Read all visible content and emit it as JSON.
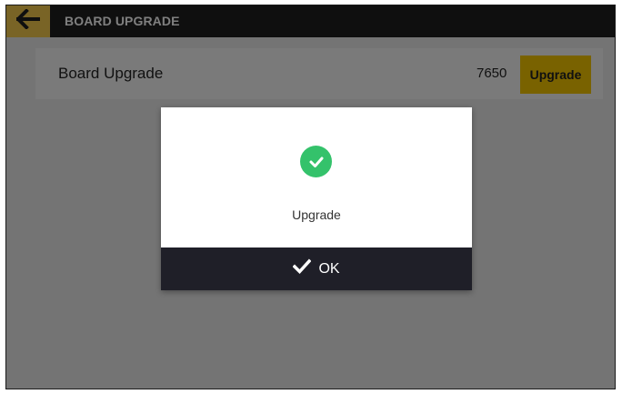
{
  "header": {
    "title": "BOARD UPGRADE",
    "back_icon": "arrow-left-icon"
  },
  "row": {
    "label": "Board Upgrade",
    "version": "7650",
    "button_label": "Upgrade"
  },
  "dialog": {
    "status_icon": "check-circle-icon",
    "message": "Upgrade",
    "ok_label": "OK",
    "ok_icon": "checkmark-icon"
  },
  "colors": {
    "accent": "#f2c400",
    "header_bg": "#1f1f1f",
    "success": "#34c26b",
    "dialog_button_bg": "#1f1f28"
  }
}
